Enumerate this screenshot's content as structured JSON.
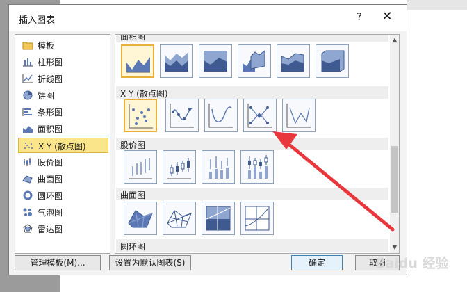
{
  "dialog": {
    "title": "插入图表",
    "help_label": "?",
    "close_label": "✕"
  },
  "sidebar": {
    "items": [
      {
        "label": "模板",
        "icon": "folder-icon"
      },
      {
        "label": "柱形图",
        "icon": "column-chart-icon"
      },
      {
        "label": "折线图",
        "icon": "line-chart-icon"
      },
      {
        "label": "饼图",
        "icon": "pie-chart-icon"
      },
      {
        "label": "条形图",
        "icon": "bar-chart-icon"
      },
      {
        "label": "面积图",
        "icon": "area-chart-icon"
      },
      {
        "label": "X Y (散点图)",
        "icon": "scatter-chart-icon"
      },
      {
        "label": "股价图",
        "icon": "stock-chart-icon"
      },
      {
        "label": "曲面图",
        "icon": "surface-chart-icon"
      },
      {
        "label": "圆环图",
        "icon": "doughnut-chart-icon"
      },
      {
        "label": "气泡图",
        "icon": "bubble-chart-icon"
      },
      {
        "label": "雷达图",
        "icon": "radar-chart-icon"
      }
    ],
    "selected_index": 6
  },
  "gallery": {
    "sections": [
      {
        "label": "面积图"
      },
      {
        "label": "X Y (散点图)"
      },
      {
        "label": "股价图"
      },
      {
        "label": "曲面图"
      },
      {
        "label": "圆环图"
      }
    ]
  },
  "buttons": {
    "manage_templates": "管理模板(M)...",
    "set_default": "设置为默认图表(S)",
    "ok": "确定",
    "cancel": "取消"
  },
  "watermark": "Baidu 经验",
  "colors": {
    "selection_fill": "#fbe58a",
    "selection_border": "#e0b53c",
    "chart_blue": "#5b78b5",
    "arrow_red": "#e8383d"
  }
}
